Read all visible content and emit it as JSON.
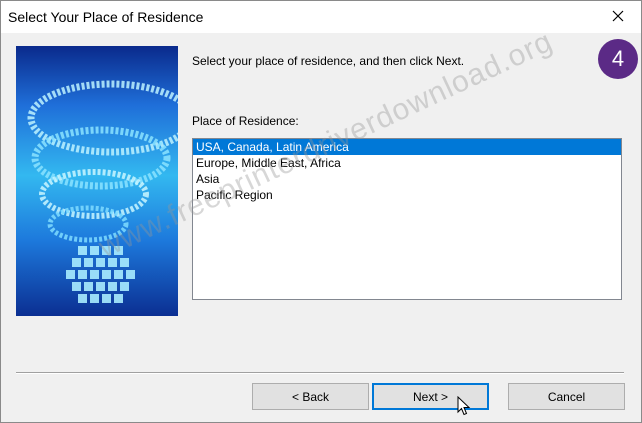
{
  "window": {
    "title": "Select Your Place of Residence",
    "close_icon": "close-icon"
  },
  "content": {
    "instruction": "Select your place of residence, and then click Next.",
    "field_label": "Place of Residence:",
    "options": [
      "USA, Canada, Latin America",
      "Europe, Middle East, Africa",
      "Asia",
      "Pacific Region"
    ],
    "selected_option": "USA, Canada, Latin America"
  },
  "buttons": {
    "back": "< Back",
    "next": "Next >",
    "cancel": "Cancel"
  },
  "overlay": {
    "step_number": "4",
    "watermark": "www.freeprinterdriverdownload.org"
  },
  "colors": {
    "selection": "#0078d7",
    "badge": "#5b2a86"
  }
}
